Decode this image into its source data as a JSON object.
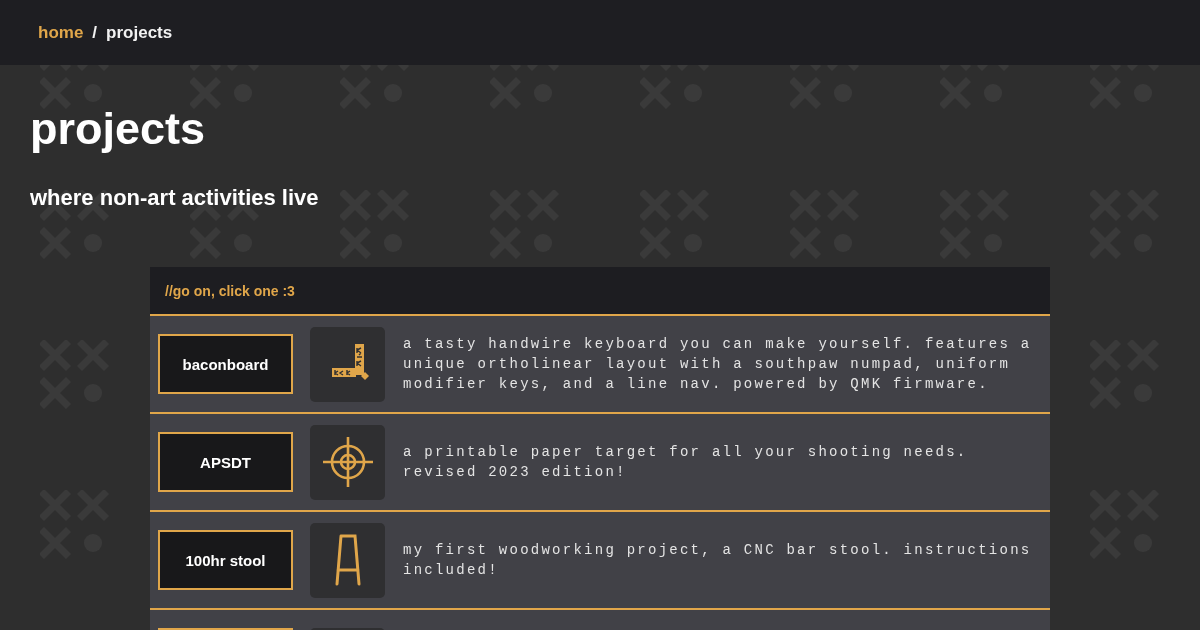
{
  "breadcrumb": [
    {
      "label": "home",
      "kind": "link"
    },
    {
      "label": "/",
      "kind": "separator"
    },
    {
      "label": "projects",
      "kind": "current"
    }
  ],
  "page": {
    "title": "projects",
    "subtitle": "where non-art activities live"
  },
  "list": {
    "header": "//go on, click one :3",
    "items": [
      {
        "name": "baconboard",
        "kind": "keyboard",
        "description": "a tasty handwire keyboard you can make yourself. features a unique ortholinear layout with a southpaw numpad, uniform modifier keys, and a line nav. powered by QMK firmware."
      },
      {
        "name": "APSDT",
        "kind": "target",
        "description": "a printable paper target for all your shooting needs. revised 2023 edition!"
      },
      {
        "name": "100hr stool",
        "kind": "stool",
        "description": "my first woodworking project, a CNC bar stool. instructions included!"
      }
    ]
  }
}
